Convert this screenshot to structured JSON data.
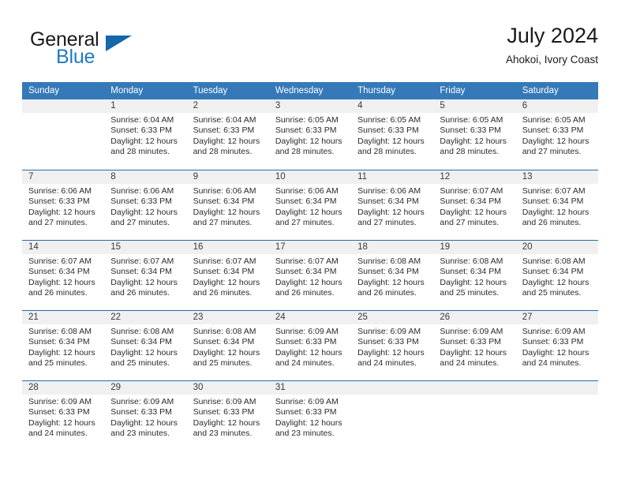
{
  "brand": {
    "name_top": "General",
    "name_bottom": "Blue",
    "accent_color": "#1566ab",
    "text_color": "#1f7ac0"
  },
  "header": {
    "month_title": "July 2024",
    "location": "Ahokoi, Ivory Coast"
  },
  "theme": {
    "header_bg": "#3579b8",
    "row_divider": "#2a6da8",
    "daynum_band": "#f0f0f0"
  },
  "calendar": {
    "weekday_headers": [
      "Sunday",
      "Monday",
      "Tuesday",
      "Wednesday",
      "Thursday",
      "Friday",
      "Saturday"
    ],
    "weeks": [
      [
        {
          "day": "",
          "lines": []
        },
        {
          "day": "1",
          "lines": [
            "Sunrise: 6:04 AM",
            "Sunset: 6:33 PM",
            "Daylight: 12 hours",
            "and 28 minutes."
          ]
        },
        {
          "day": "2",
          "lines": [
            "Sunrise: 6:04 AM",
            "Sunset: 6:33 PM",
            "Daylight: 12 hours",
            "and 28 minutes."
          ]
        },
        {
          "day": "3",
          "lines": [
            "Sunrise: 6:05 AM",
            "Sunset: 6:33 PM",
            "Daylight: 12 hours",
            "and 28 minutes."
          ]
        },
        {
          "day": "4",
          "lines": [
            "Sunrise: 6:05 AM",
            "Sunset: 6:33 PM",
            "Daylight: 12 hours",
            "and 28 minutes."
          ]
        },
        {
          "day": "5",
          "lines": [
            "Sunrise: 6:05 AM",
            "Sunset: 6:33 PM",
            "Daylight: 12 hours",
            "and 28 minutes."
          ]
        },
        {
          "day": "6",
          "lines": [
            "Sunrise: 6:05 AM",
            "Sunset: 6:33 PM",
            "Daylight: 12 hours",
            "and 27 minutes."
          ]
        }
      ],
      [
        {
          "day": "7",
          "lines": [
            "Sunrise: 6:06 AM",
            "Sunset: 6:33 PM",
            "Daylight: 12 hours",
            "and 27 minutes."
          ]
        },
        {
          "day": "8",
          "lines": [
            "Sunrise: 6:06 AM",
            "Sunset: 6:33 PM",
            "Daylight: 12 hours",
            "and 27 minutes."
          ]
        },
        {
          "day": "9",
          "lines": [
            "Sunrise: 6:06 AM",
            "Sunset: 6:34 PM",
            "Daylight: 12 hours",
            "and 27 minutes."
          ]
        },
        {
          "day": "10",
          "lines": [
            "Sunrise: 6:06 AM",
            "Sunset: 6:34 PM",
            "Daylight: 12 hours",
            "and 27 minutes."
          ]
        },
        {
          "day": "11",
          "lines": [
            "Sunrise: 6:06 AM",
            "Sunset: 6:34 PM",
            "Daylight: 12 hours",
            "and 27 minutes."
          ]
        },
        {
          "day": "12",
          "lines": [
            "Sunrise: 6:07 AM",
            "Sunset: 6:34 PM",
            "Daylight: 12 hours",
            "and 27 minutes."
          ]
        },
        {
          "day": "13",
          "lines": [
            "Sunrise: 6:07 AM",
            "Sunset: 6:34 PM",
            "Daylight: 12 hours",
            "and 26 minutes."
          ]
        }
      ],
      [
        {
          "day": "14",
          "lines": [
            "Sunrise: 6:07 AM",
            "Sunset: 6:34 PM",
            "Daylight: 12 hours",
            "and 26 minutes."
          ]
        },
        {
          "day": "15",
          "lines": [
            "Sunrise: 6:07 AM",
            "Sunset: 6:34 PM",
            "Daylight: 12 hours",
            "and 26 minutes."
          ]
        },
        {
          "day": "16",
          "lines": [
            "Sunrise: 6:07 AM",
            "Sunset: 6:34 PM",
            "Daylight: 12 hours",
            "and 26 minutes."
          ]
        },
        {
          "day": "17",
          "lines": [
            "Sunrise: 6:07 AM",
            "Sunset: 6:34 PM",
            "Daylight: 12 hours",
            "and 26 minutes."
          ]
        },
        {
          "day": "18",
          "lines": [
            "Sunrise: 6:08 AM",
            "Sunset: 6:34 PM",
            "Daylight: 12 hours",
            "and 26 minutes."
          ]
        },
        {
          "day": "19",
          "lines": [
            "Sunrise: 6:08 AM",
            "Sunset: 6:34 PM",
            "Daylight: 12 hours",
            "and 25 minutes."
          ]
        },
        {
          "day": "20",
          "lines": [
            "Sunrise: 6:08 AM",
            "Sunset: 6:34 PM",
            "Daylight: 12 hours",
            "and 25 minutes."
          ]
        }
      ],
      [
        {
          "day": "21",
          "lines": [
            "Sunrise: 6:08 AM",
            "Sunset: 6:34 PM",
            "Daylight: 12 hours",
            "and 25 minutes."
          ]
        },
        {
          "day": "22",
          "lines": [
            "Sunrise: 6:08 AM",
            "Sunset: 6:34 PM",
            "Daylight: 12 hours",
            "and 25 minutes."
          ]
        },
        {
          "day": "23",
          "lines": [
            "Sunrise: 6:08 AM",
            "Sunset: 6:34 PM",
            "Daylight: 12 hours",
            "and 25 minutes."
          ]
        },
        {
          "day": "24",
          "lines": [
            "Sunrise: 6:09 AM",
            "Sunset: 6:33 PM",
            "Daylight: 12 hours",
            "and 24 minutes."
          ]
        },
        {
          "day": "25",
          "lines": [
            "Sunrise: 6:09 AM",
            "Sunset: 6:33 PM",
            "Daylight: 12 hours",
            "and 24 minutes."
          ]
        },
        {
          "day": "26",
          "lines": [
            "Sunrise: 6:09 AM",
            "Sunset: 6:33 PM",
            "Daylight: 12 hours",
            "and 24 minutes."
          ]
        },
        {
          "day": "27",
          "lines": [
            "Sunrise: 6:09 AM",
            "Sunset: 6:33 PM",
            "Daylight: 12 hours",
            "and 24 minutes."
          ]
        }
      ],
      [
        {
          "day": "28",
          "lines": [
            "Sunrise: 6:09 AM",
            "Sunset: 6:33 PM",
            "Daylight: 12 hours",
            "and 24 minutes."
          ]
        },
        {
          "day": "29",
          "lines": [
            "Sunrise: 6:09 AM",
            "Sunset: 6:33 PM",
            "Daylight: 12 hours",
            "and 23 minutes."
          ]
        },
        {
          "day": "30",
          "lines": [
            "Sunrise: 6:09 AM",
            "Sunset: 6:33 PM",
            "Daylight: 12 hours",
            "and 23 minutes."
          ]
        },
        {
          "day": "31",
          "lines": [
            "Sunrise: 6:09 AM",
            "Sunset: 6:33 PM",
            "Daylight: 12 hours",
            "and 23 minutes."
          ]
        },
        {
          "day": "",
          "lines": []
        },
        {
          "day": "",
          "lines": []
        },
        {
          "day": "",
          "lines": []
        }
      ]
    ]
  }
}
